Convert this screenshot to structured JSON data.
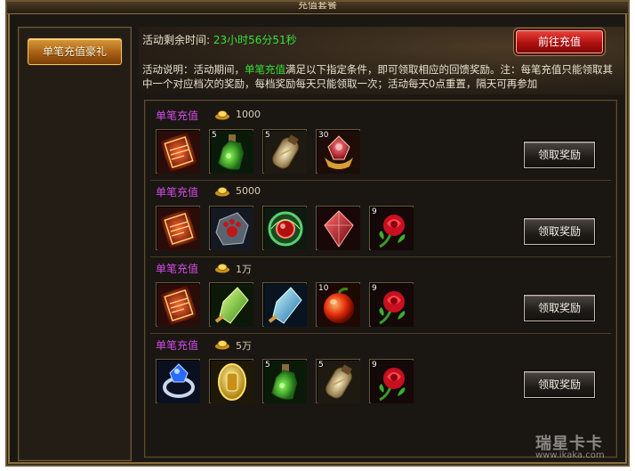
{
  "window": {
    "title": "充值套餐"
  },
  "sidebar": {
    "tab_label": "单笔充值豪礼"
  },
  "header": {
    "timer_label": "活动剩余时间:",
    "timer_value": "23小时56分51秒",
    "goto_button": "前往充值",
    "desc_prefix": "活动说明：活动期间，",
    "desc_highlight": "单笔充值",
    "desc_suffix": "满足以下指定条件，即可领取相应的回馈奖励。注：每笔充值只能领取其中一个对应档次的奖励，每档奖励每天只能领取一次；活动每天0点重置，隔天可再参加"
  },
  "colors": {
    "accent_green": "#36e03a",
    "tier_title": "#d24ce8",
    "goto_red": "#b0110f",
    "tab_orange": "#a85f14"
  },
  "tiers": [
    {
      "title": "单笔充值",
      "amount": "1000",
      "claim_label": "领取奖励",
      "items": [
        {
          "icon": "scroll-icon",
          "count": ""
        },
        {
          "icon": "green-potion-icon",
          "count": "5"
        },
        {
          "icon": "gold-potion-icon",
          "count": "5"
        },
        {
          "icon": "ruby-treasure-icon",
          "count": "30"
        }
      ]
    },
    {
      "title": "单笔充值",
      "amount": "5000",
      "claim_label": "领取奖励",
      "items": [
        {
          "icon": "scroll-icon",
          "count": ""
        },
        {
          "icon": "paw-stone-icon",
          "count": ""
        },
        {
          "icon": "red-gem-ring-icon",
          "count": ""
        },
        {
          "icon": "red-crystal-icon",
          "count": ""
        },
        {
          "icon": "rose-icon",
          "count": "9"
        }
      ]
    },
    {
      "title": "单笔充值",
      "amount": "1万",
      "claim_label": "领取奖励",
      "items": [
        {
          "icon": "scroll-icon",
          "count": ""
        },
        {
          "icon": "green-crystal-shard-icon",
          "count": ""
        },
        {
          "icon": "blue-crystal-shard-icon",
          "count": ""
        },
        {
          "icon": "red-fruit-icon",
          "count": "10"
        },
        {
          "icon": "rose-icon",
          "count": "9"
        }
      ]
    },
    {
      "title": "单笔充值",
      "amount": "5万",
      "claim_label": "领取奖励",
      "items": [
        {
          "icon": "blue-gem-ring-icon",
          "count": ""
        },
        {
          "icon": "gold-medal-icon",
          "count": ""
        },
        {
          "icon": "green-potion-icon",
          "count": "5"
        },
        {
          "icon": "gold-potion-icon",
          "count": "5"
        },
        {
          "icon": "rose-icon",
          "count": "9"
        }
      ]
    }
  ],
  "watermark": {
    "brand": "瑞星卡卡",
    "url": "www.ikaka.com"
  }
}
